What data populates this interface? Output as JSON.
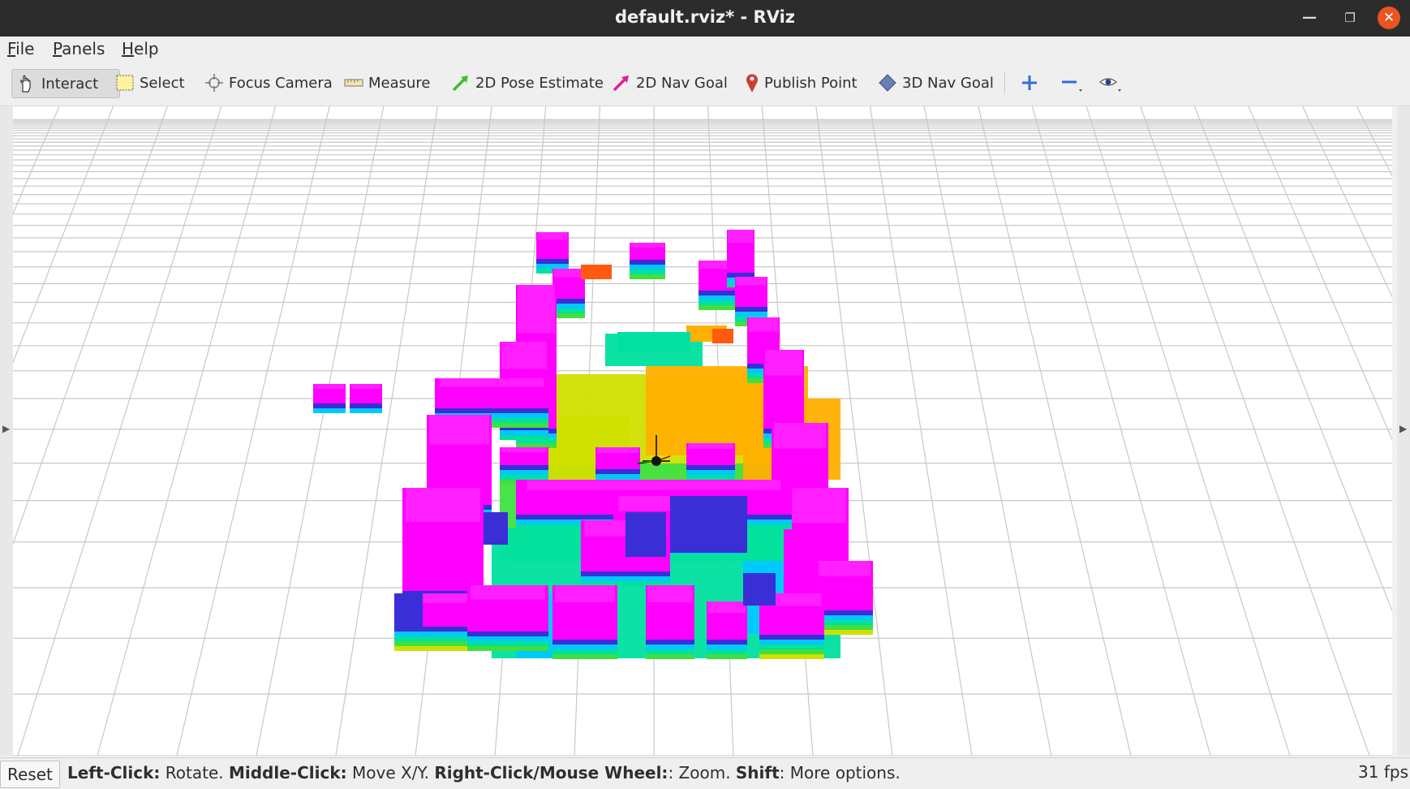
{
  "window": {
    "title": "default.rviz* - RViz",
    "minimize_glyph": "—",
    "maximize_glyph": "❐",
    "close_glyph": "✕"
  },
  "menubar": [
    {
      "accel": "F",
      "rest": "ile"
    },
    {
      "accel": "P",
      "rest": "anels"
    },
    {
      "accel": "H",
      "rest": "elp"
    }
  ],
  "toolbar": {
    "interact": "Interact",
    "select": "Select",
    "focus_camera": "Focus Camera",
    "measure": "Measure",
    "pose_estimate": "2D Pose Estimate",
    "nav_goal_2d": "2D Nav Goal",
    "publish_point": "Publish Point",
    "nav_goal_3d": "3D Nav Goal",
    "icons": [
      "hand-icon",
      "select-box-icon",
      "crosshair-icon",
      "ruler-icon",
      "green-arrow-icon",
      "pink-arrow-icon",
      "map-pin-icon",
      "diamond-icon",
      "plus-icon",
      "minus-icon",
      "eye-icon"
    ],
    "colors": {
      "pose_arrow": "#3fbf2f",
      "nav_arrow": "#e0209f",
      "pin": "#c84030",
      "diamond": "#6a7fb5",
      "tool_blue": "#2f6fd0"
    }
  },
  "status": {
    "reset": "Reset",
    "k1": "Left-Click:",
    "v1": " Rotate. ",
    "k2": "Middle-Click:",
    "v2": " Move X/Y. ",
    "k3": "Right-Click/Mouse Wheel:",
    "v3": ": Zoom. ",
    "k4": "Shift",
    "v4": ": More options.",
    "fps": "31 fps"
  },
  "viewport": {
    "background": "#ffffff",
    "grid_color": "#c8c8c8",
    "voxel_colors": [
      "#ff00ff",
      "#3a2fd6",
      "#00c8ff",
      "#00e0a0",
      "#40e040",
      "#d0e000",
      "#ffb000",
      "#ff5a10"
    ]
  }
}
